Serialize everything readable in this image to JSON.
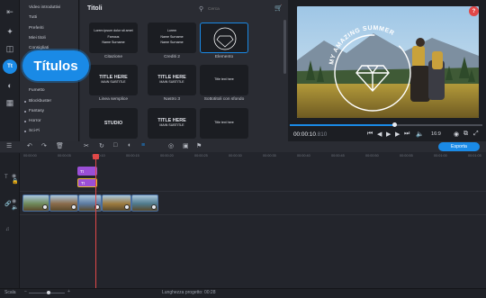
{
  "rail": {
    "active_label": "Tt"
  },
  "categories": [
    {
      "label": "Video introduttivi",
      "bullet": false
    },
    {
      "label": "Tutti",
      "bullet": false
    },
    {
      "label": "Preferiti",
      "bullet": false
    },
    {
      "label": "Miei titoli",
      "bullet": false
    },
    {
      "label": "Consigliati",
      "bullet": false
    },
    {
      "label": "Fumetto",
      "bullet": false
    },
    {
      "label": "Blockbuster",
      "bullet": true
    },
    {
      "label": "Fantasy",
      "bullet": true
    },
    {
      "label": "Horror",
      "bullet": true
    },
    {
      "label": "Sci-Fi",
      "bullet": true
    }
  ],
  "tooltip": {
    "label": "Títulos"
  },
  "panel": {
    "title": "Titoli",
    "search_placeholder": "Cerca",
    "thumbnails": [
      {
        "label": "Citazione",
        "lines": [
          "Lorem ipsum dolor sit amet",
          "Famous",
          "Name Surname"
        ]
      },
      {
        "label": "Crediti 2",
        "lines": [
          "Lorem",
          "Name Surname",
          "Name Surname"
        ]
      },
      {
        "label": "Elemento",
        "lines": [],
        "selected": true
      },
      {
        "label": "Linea semplice",
        "lines": [
          "TITLE HERE",
          "MAIN SUBTITLE"
        ]
      },
      {
        "label": "Nastro 3",
        "lines": [
          "TITLE HERE",
          "MAIN SUBTITLE"
        ]
      },
      {
        "label": "Sottotitoli con sfondo",
        "lines": [
          "Title text here"
        ]
      },
      {
        "label": "",
        "lines": [
          "STUDIO"
        ]
      },
      {
        "label": "",
        "lines": [
          "TITLE HERE",
          "MAIN SUBTITLE"
        ]
      },
      {
        "label": "",
        "lines": [
          "Title text here"
        ]
      }
    ]
  },
  "preview": {
    "overlay_text": "MY AMAZING SUMMER",
    "timecode": "00:00:10",
    "timecode_frac": ".810",
    "aspect": "16:9"
  },
  "toolbar": {
    "export_label": "Esporta"
  },
  "timeline": {
    "ticks": [
      "00:00:00",
      "00:00:05",
      "00:00:10",
      "00:00:15",
      "00:00:20",
      "00:00:25",
      "00:00:30",
      "00:00:35",
      "00:00:40",
      "00:00:45",
      "00:00:50",
      "00:00:55",
      "00:01:00",
      "00:01:05"
    ],
    "title_clips": [
      "Tt",
      "Tt"
    ]
  },
  "status": {
    "scale_label": "Scala",
    "duration_label": "Lunghezza progetto:",
    "duration_value": "00:28"
  }
}
